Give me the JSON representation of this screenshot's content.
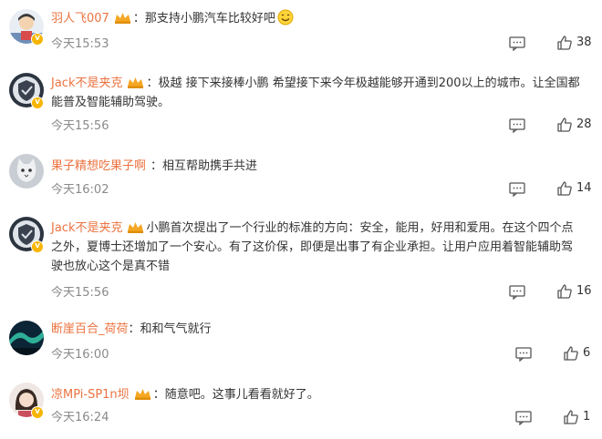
{
  "comments": [
    {
      "username": "羽人飞007",
      "separator": "：",
      "text": "那支持小鹏汽车比较好吧",
      "emoji": "smile-emoji",
      "time": "今天15:53",
      "likes": "38",
      "avatar_icon": "cartoon-avatar-icon"
    },
    {
      "username": "Jack不是夹克",
      "separator": "：",
      "text": "极越 接下来接棒小鹏 希望接下来今年极越能够开通到200以上的城市。让全国都能普及智能辅助驾驶。",
      "time": "今天15:56",
      "likes": "28",
      "avatar_icon": "shield-avatar-icon"
    },
    {
      "username": "果子精想吃果子啊",
      "separator": "：",
      "text": "相互帮助携手共进",
      "time": "今天16:02",
      "likes": "14",
      "avatar_icon": "cat-avatar-icon"
    },
    {
      "username": "Jack不是夹克",
      "separator": "：",
      "text": "小鹏首次提出了一个行业的标准的方向：安全，能用，好用和爱用。在这个四个点之外，夏博士还增加了一个安心。有了这价保，即便是出事了有企业承担。让用户应用着智能辅助驾驶也放心这个是真不错",
      "time": "今天15:56",
      "likes": "16",
      "avatar_icon": "shield-avatar-icon"
    },
    {
      "username": "断崖百合_荷荷",
      "separator": "：",
      "text": "和和气气就行",
      "time": "今天16:00",
      "likes": "6",
      "avatar_icon": "aurora-avatar-icon"
    },
    {
      "username": "凉MPi-SP1n坝",
      "separator": "：",
      "text": "随意吧。这事儿看看就好了。",
      "time": "今天16:24",
      "likes": "1",
      "avatar_icon": "girl-avatar-icon"
    }
  ],
  "colors": {
    "username": "#eb7340",
    "verified_badge": "#f7b500",
    "text": "#333333",
    "meta": "#8a8a8a"
  },
  "icons": {
    "member": "crown-icon",
    "reply": "reply-icon",
    "like": "thumb-up-icon",
    "verified": "verified-badge-icon"
  }
}
